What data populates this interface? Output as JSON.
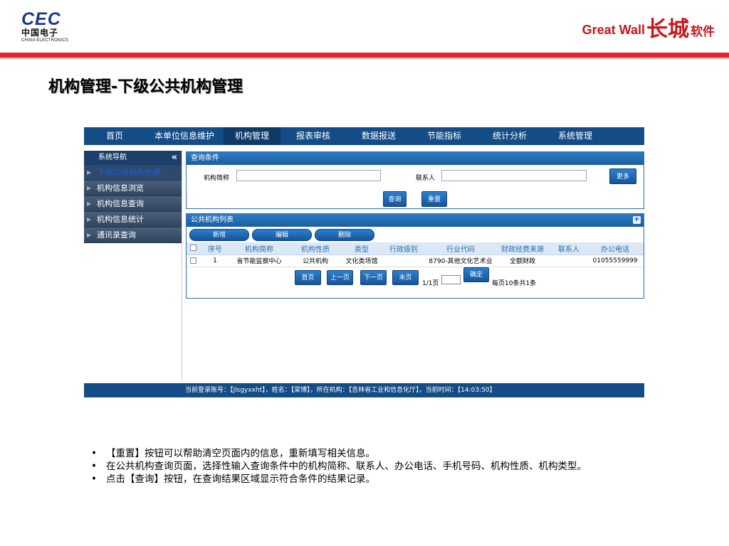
{
  "slide": {
    "logo_left": {
      "mark": "CEC",
      "cn": "中国电子",
      "en": "CHINA ELECTRONICS"
    },
    "logo_right": {
      "text": "Great Wall",
      "glyph": "长城",
      "suffix": "软件"
    },
    "title": "机构管理-下级公共机构管理",
    "accent_color": "#e3272e"
  },
  "app": {
    "nav": [
      {
        "label": "首页"
      },
      {
        "label": "本单位信息维护"
      },
      {
        "label": "机构管理",
        "active": true
      },
      {
        "label": "报表审核"
      },
      {
        "label": "数据报送"
      },
      {
        "label": "节能指标"
      },
      {
        "label": "统计分析"
      },
      {
        "label": "系统管理"
      }
    ],
    "sidebar": {
      "title": "系统导航",
      "collapse_symbol": "«",
      "items": [
        {
          "label": "下级公共机构管理",
          "active": true
        },
        {
          "label": "机构信息浏览"
        },
        {
          "label": "机构信息查询"
        },
        {
          "label": "机构信息统计"
        },
        {
          "label": "通讯录查询"
        }
      ]
    },
    "query": {
      "title": "查询条件",
      "name_label": "机构简称",
      "name_value": "",
      "contact_label": "联系人",
      "contact_value": "",
      "more_label": "更多",
      "search_label": "查询",
      "reset_label": "重置"
    },
    "list": {
      "title": "公共机构列表",
      "add_label": "新增",
      "edit_label": "编辑",
      "delete_label": "删除",
      "columns": [
        "",
        "序号",
        "机构简称",
        "机构性质",
        "类型",
        "行政级别",
        "行业代码",
        "财政经费来源",
        "联系人",
        "办公电话"
      ],
      "rows": [
        [
          "",
          "1",
          "省节能监察中心",
          "公共机构",
          "文化类场馆",
          "",
          "8790-其他文化艺术业",
          "全额财政",
          "",
          "01055559999"
        ]
      ]
    },
    "pager": {
      "first": "首页",
      "prev": "上一页",
      "next": "下一页",
      "last": "末页",
      "page_info": "1/1页",
      "page_input": "",
      "confirm": "确定",
      "summary": "每页10条共1条"
    },
    "footer": "当前登录账号：【jlsgyxxht】，姓名：【梁博】，所在机构：【吉林省工业和信息化厅】，当前时间：【14:03:50】"
  },
  "bullets": [
    "【重置】按钮可以帮助清空页面内的信息，重新填写相关信息。",
    "在公共机构查询页面，选择性输入查询条件中的机构简称、联系人、办公电话、手机号码、机构性质、机构类型。",
    "点击【查询】按钮，在查询结果区域显示符合条件的结果记录。"
  ]
}
